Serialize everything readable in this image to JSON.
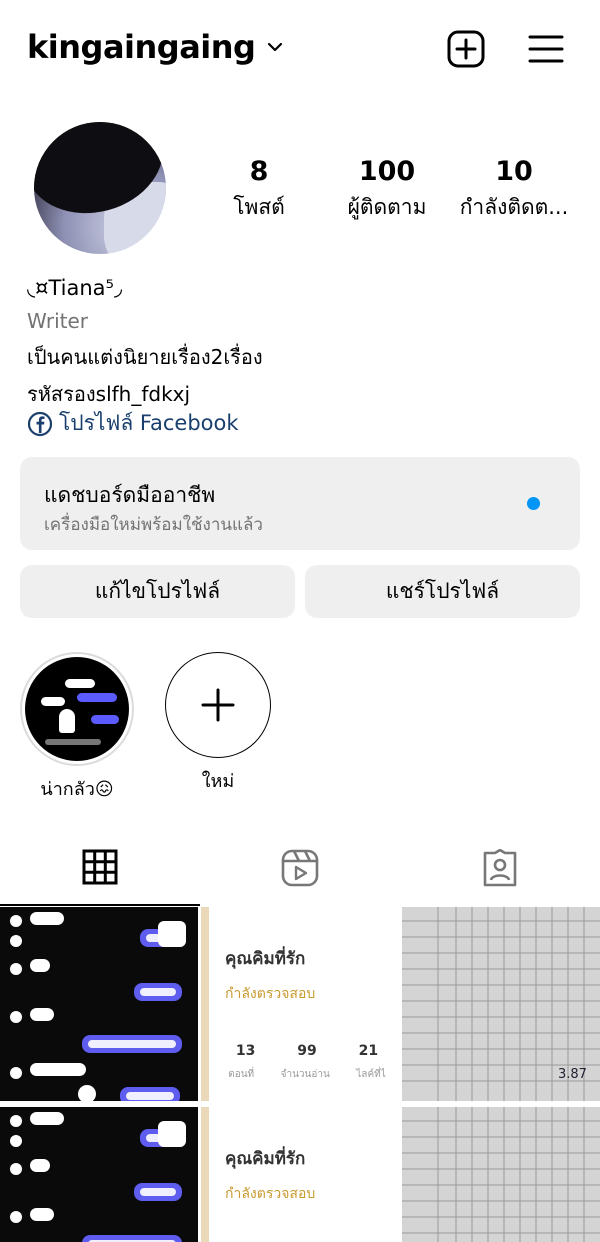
{
  "header": {
    "username": "kingaingaing",
    "icons": [
      "chevron-down-icon",
      "add-post-icon",
      "menu-icon"
    ]
  },
  "profile": {
    "stats": {
      "posts_count": "8",
      "posts_label": "โพสต์",
      "followers_count": "100",
      "followers_label": "ผู้ติดตาม",
      "following_count": "10",
      "following_label": "กำลังติดต..."
    },
    "display_name": "◟¤Tiana⁵◞",
    "category": "Writer",
    "bio_line1": "เป็นคนแต่งนิยายเรื่อง2เรื่อง",
    "bio_line2": "รหัสรองslfh_fdkxj",
    "facebook_link": "โปรไฟล์ Facebook"
  },
  "dashboard": {
    "title": "แดชบอร์ดมืออาชีพ",
    "subtitle": "เครื่องมือใหม่พร้อมใช้งานแล้ว",
    "dot_color": "#0095f6"
  },
  "buttons": {
    "edit_profile": "แก้ไขโปรไฟล์",
    "share_profile": "แชร์โปรไฟล์"
  },
  "highlights": [
    {
      "label": "น่ากลัว😖"
    },
    {
      "label": "ใหม่"
    }
  ],
  "tabs": [
    "grid-icon",
    "reels-icon",
    "tagged-icon"
  ],
  "posts": {
    "story_card": {
      "title": "คุณคิมที่รัก",
      "status": "กำลังตรวจสอบ",
      "stat1": "13",
      "stat2": "99",
      "stat3": "21",
      "lab1": "ตอนที่",
      "lab2": "จำนวนอ่าน",
      "lab3": "ไลค์ที่ไ"
    },
    "sheet_value": "3.87"
  }
}
